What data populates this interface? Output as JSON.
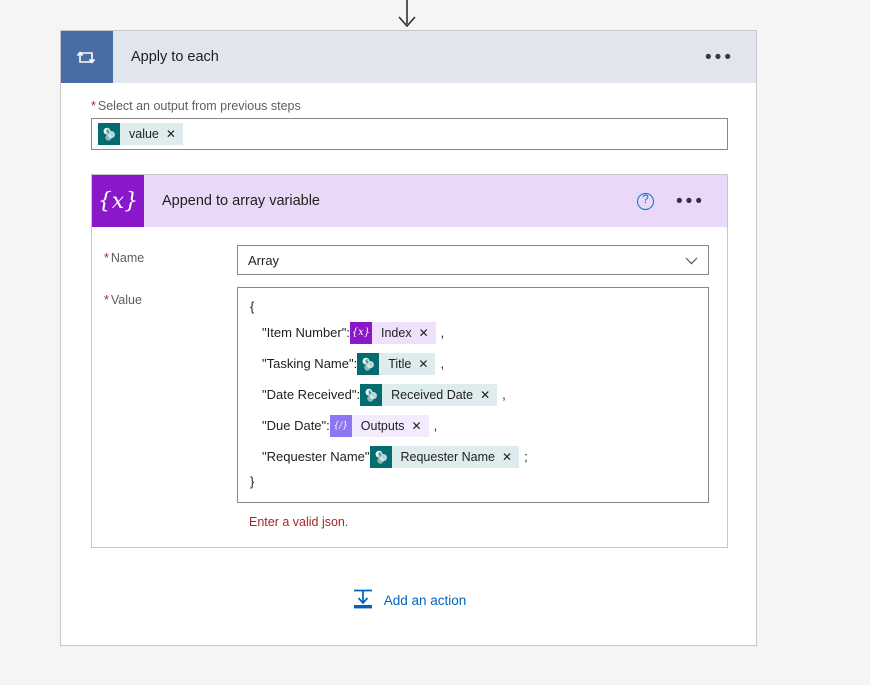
{
  "connector": {
    "icon": "arrow-down-icon"
  },
  "loop": {
    "icon": "apply-to-each-loop-icon",
    "title": "Apply to each",
    "more_label": "•••",
    "output_field": {
      "required_marker": "*",
      "label": "Select an output from previous steps",
      "token": {
        "icon": "sharepoint-icon",
        "text": "value",
        "remove": "✕"
      }
    }
  },
  "action": {
    "icon": "variable-icon",
    "icon_glyph": "{x}",
    "title": "Append to array variable",
    "help_label": "?",
    "more_label": "•••",
    "name_field": {
      "required_marker": "*",
      "label": "Name",
      "value": "Array",
      "chevron": "chevron-down-icon"
    },
    "value_field": {
      "required_marker": "*",
      "label": "Value",
      "open_brace": "{",
      "close_brace": "}",
      "rows": [
        {
          "key": "\"Item Number\":",
          "token": {
            "kind": "variable",
            "icon": "variable-icon",
            "glyph": "{x}",
            "text": "Index",
            "remove": "✕"
          },
          "trailing": ","
        },
        {
          "key": "\"Tasking Name\":",
          "token": {
            "kind": "sharepoint",
            "icon": "sharepoint-icon",
            "glyph": "",
            "text": "Title",
            "remove": "✕"
          },
          "trailing": ","
        },
        {
          "key": "\"Date Received\":",
          "token": {
            "kind": "sharepoint",
            "icon": "sharepoint-icon",
            "glyph": "",
            "text": "Received Date",
            "remove": "✕"
          },
          "trailing": ","
        },
        {
          "key": "\"Due Date\":",
          "token": {
            "kind": "compose",
            "icon": "compose-outputs-icon",
            "glyph": "{∕}",
            "text": "Outputs",
            "remove": "✕"
          },
          "trailing": ","
        },
        {
          "key": "\"Requester Name\"",
          "token": {
            "kind": "sharepoint",
            "icon": "sharepoint-icon",
            "glyph": "",
            "text": "Requester Name",
            "remove": "✕"
          },
          "trailing": ";"
        }
      ],
      "error": "Enter a valid json."
    }
  },
  "add_action": {
    "icon": "add-action-insert-icon",
    "label": "Add an action"
  },
  "colors": {
    "page_bg": "#f5f5f5",
    "loop_header_bg": "#e1e5ee",
    "loop_icon_bg": "#486ca5",
    "action_header_bg": "#e9d8f7",
    "variable_purple": "#8a17c9",
    "variable_chip_bg": "#f0e0fb",
    "sharepoint_teal": "#036c70",
    "sharepoint_chip_bg": "#dfeced",
    "compose_purple": "#8e76f0",
    "compose_chip_bg": "#f1ebfd",
    "error_red": "#a4262c",
    "link_blue": "#0064bf",
    "help_blue": "#0078d4"
  }
}
